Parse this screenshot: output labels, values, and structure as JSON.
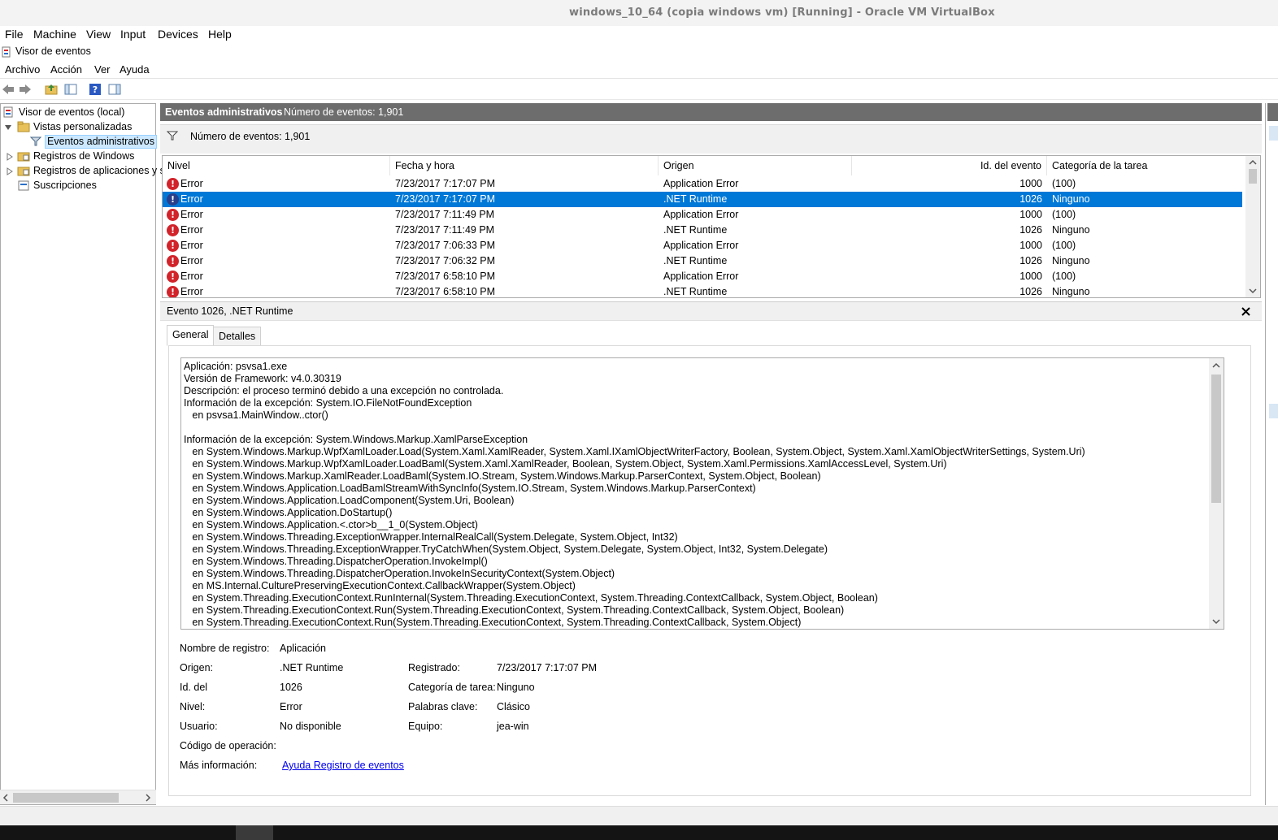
{
  "vbox": {
    "title": "windows_10_64 (copia windows vm) [Running] - Oracle VM VirtualBox",
    "menu": [
      "File",
      "Machine",
      "View",
      "Input",
      "Devices",
      "Help"
    ]
  },
  "app": {
    "title": "Visor de eventos",
    "menu": [
      "Archivo",
      "Acción",
      "Ver",
      "Ayuda"
    ]
  },
  "tree": {
    "root": "Visor de eventos (local)",
    "items": [
      {
        "label": "Vistas personalizadas"
      },
      {
        "label": "Eventos administrativos"
      },
      {
        "label": "Registros de Windows"
      },
      {
        "label": "Registros de aplicaciones y s"
      },
      {
        "label": "Suscripciones"
      }
    ]
  },
  "main": {
    "header_title": "Eventos administrativos",
    "header_count": "Número de eventos: 1,901",
    "filter_count": "Número de eventos: 1,901",
    "columns": [
      "Nivel",
      "Fecha y hora",
      "Origen",
      "Id. del evento",
      "Categoría de la tarea"
    ],
    "rows": [
      {
        "level": "Error",
        "date": "7/23/2017 7:17:07 PM",
        "source": "Application Error",
        "id": "1000",
        "category": "(100)"
      },
      {
        "level": "Error",
        "date": "7/23/2017 7:17:07 PM",
        "source": ".NET Runtime",
        "id": "1026",
        "category": "Ninguno"
      },
      {
        "level": "Error",
        "date": "7/23/2017 7:11:49 PM",
        "source": "Application Error",
        "id": "1000",
        "category": "(100)"
      },
      {
        "level": "Error",
        "date": "7/23/2017 7:11:49 PM",
        "source": ".NET Runtime",
        "id": "1026",
        "category": "Ninguno"
      },
      {
        "level": "Error",
        "date": "7/23/2017 7:06:33 PM",
        "source": "Application Error",
        "id": "1000",
        "category": "(100)"
      },
      {
        "level": "Error",
        "date": "7/23/2017 7:06:32 PM",
        "source": ".NET Runtime",
        "id": "1026",
        "category": "Ninguno"
      },
      {
        "level": "Error",
        "date": "7/23/2017 6:58:10 PM",
        "source": "Application Error",
        "id": "1000",
        "category": "(100)"
      },
      {
        "level": "Error",
        "date": "7/23/2017 6:58:10 PM",
        "source": ".NET Runtime",
        "id": "1026",
        "category": "Ninguno"
      }
    ]
  },
  "detail": {
    "title": "Evento 1026, .NET Runtime",
    "tabs": [
      "General",
      "Detalles"
    ],
    "text_lines": [
      "Aplicación: psvsa1.exe",
      "Versión de Framework: v4.0.30319",
      "Descripción: el proceso terminó debido a una excepción no controlada.",
      "Información de la excepción: System.IO.FileNotFoundException",
      "   en psvsa1.MainWindow..ctor()",
      "",
      "Información de la excepción: System.Windows.Markup.XamlParseException",
      "   en System.Windows.Markup.WpfXamlLoader.Load(System.Xaml.XamlReader, System.Xaml.IXamlObjectWriterFactory, Boolean, System.Object, System.Xaml.XamlObjectWriterSettings, System.Uri)",
      "   en System.Windows.Markup.WpfXamlLoader.LoadBaml(System.Xaml.XamlReader, Boolean, System.Object, System.Xaml.Permissions.XamlAccessLevel, System.Uri)",
      "   en System.Windows.Markup.XamlReader.LoadBaml(System.IO.Stream, System.Windows.Markup.ParserContext, System.Object, Boolean)",
      "   en System.Windows.Application.LoadBamlStreamWithSyncInfo(System.IO.Stream, System.Windows.Markup.ParserContext)",
      "   en System.Windows.Application.LoadComponent(System.Uri, Boolean)",
      "   en System.Windows.Application.DoStartup()",
      "   en System.Windows.Application.<.ctor>b__1_0(System.Object)",
      "   en System.Windows.Threading.ExceptionWrapper.InternalRealCall(System.Delegate, System.Object, Int32)",
      "   en System.Windows.Threading.ExceptionWrapper.TryCatchWhen(System.Object, System.Delegate, System.Object, Int32, System.Delegate)",
      "   en System.Windows.Threading.DispatcherOperation.InvokeImpl()",
      "   en System.Windows.Threading.DispatcherOperation.InvokeInSecurityContext(System.Object)",
      "   en MS.Internal.CulturePreservingExecutionContext.CallbackWrapper(System.Object)",
      "   en System.Threading.ExecutionContext.RunInternal(System.Threading.ExecutionContext, System.Threading.ContextCallback, System.Object, Boolean)",
      "   en System.Threading.ExecutionContext.Run(System.Threading.ExecutionContext, System.Threading.ContextCallback, System.Object, Boolean)",
      "   en System.Threading.ExecutionContext.Run(System.Threading.ExecutionContext, System.Threading.ContextCallback, System.Object)"
    ],
    "props": {
      "log_name_label": "Nombre de registro:",
      "log_name": "Aplicación",
      "source_label": "Origen:",
      "source": ".NET Runtime",
      "logged_label": "Registrado:",
      "logged": "7/23/2017 7:17:07 PM",
      "id_label": "Id. del",
      "id": "1026",
      "task_label": "Categoría de tarea:",
      "task": "Ninguno",
      "level_label": "Nivel:",
      "level": "Error",
      "keywords_label": "Palabras clave:",
      "keywords": "Clásico",
      "user_label": "Usuario:",
      "user": "No disponible",
      "computer_label": "Equipo:",
      "computer": "jea-win",
      "opcode_label": "Código de operación:",
      "more_info_label": "Más información:",
      "more_info_link": "Ayuda Registro de eventos"
    }
  },
  "colors": {
    "selection": "#0078d7",
    "header_bg": "#6d6d6d",
    "error_icon": "#d2232a",
    "link": "#0000ee"
  }
}
